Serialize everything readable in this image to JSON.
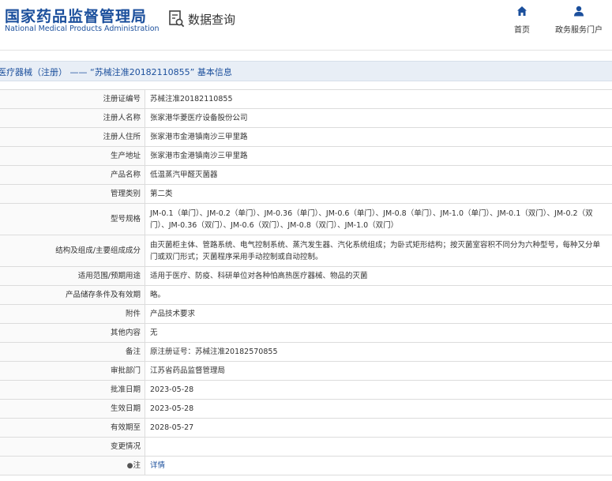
{
  "header": {
    "logo_cn": "国家药品监督管理局",
    "logo_en": "National Medical Products Administration",
    "query_label": "数据查询",
    "nav": [
      {
        "label": "首页",
        "icon": "home-icon"
      },
      {
        "label": "政务服务门户",
        "icon": "user-icon"
      }
    ],
    "brand_color": "#1b4f9c"
  },
  "title": {
    "text": "医疗器械（注册） —— “苏械注准20182110855” 基本信息"
  },
  "rows": [
    {
      "label": "注册证编号",
      "value": "苏械注准20182110855"
    },
    {
      "label": "注册人名称",
      "value": "张家港华菱医疗设备股份公司"
    },
    {
      "label": "注册人住所",
      "value": "张家港市金港镇南沙三甲里路"
    },
    {
      "label": "生产地址",
      "value": "张家港市金港镇南沙三甲里路"
    },
    {
      "label": "产品名称",
      "value": "低温蒸汽甲醛灭菌器"
    },
    {
      "label": "管理类别",
      "value": "第二类"
    },
    {
      "label": "型号规格",
      "value": "JM-0.1（单门）、JM-0.2（单门）、JM-0.36（单门）、JM-0.6（单门）、JM-0.8（单门）、JM-1.0（单门）、JM-0.1（双门）、JM-0.2（双门）、JM-0.36（双门）、JM-0.6（双门）、JM-0.8（双门）、JM-1.0（双门）"
    },
    {
      "label": "结构及组成/主要组成成分",
      "value": "由灭菌柜主体、管路系统、电气控制系统、蒸汽发生器、汽化系统组成；为卧式矩形结构；按灭菌室容积不同分为六种型号，每种又分单门或双门形式；灭菌程序采用手动控制或自动控制。"
    },
    {
      "label": "适用范围/预期用途",
      "value": "适用于医疗、防疫、科研单位对各种怕高热医疗器械、物品的灭菌"
    },
    {
      "label": "产品储存条件及有效期",
      "value": "略。"
    },
    {
      "label": "附件",
      "value": "产品技术要求"
    },
    {
      "label": "其他内容",
      "value": "无"
    },
    {
      "label": "备注",
      "value": "原注册证号：苏械注准20182570855"
    },
    {
      "label": "审批部门",
      "value": "江苏省药品监督管理局"
    },
    {
      "label": "批准日期",
      "value": "2023-05-28"
    },
    {
      "label": "生效日期",
      "value": "2023-05-28"
    },
    {
      "label": "有效期至",
      "value": "2028-05-27"
    },
    {
      "label": "变更情况",
      "value": ""
    },
    {
      "label": "注",
      "value": "详情"
    }
  ]
}
